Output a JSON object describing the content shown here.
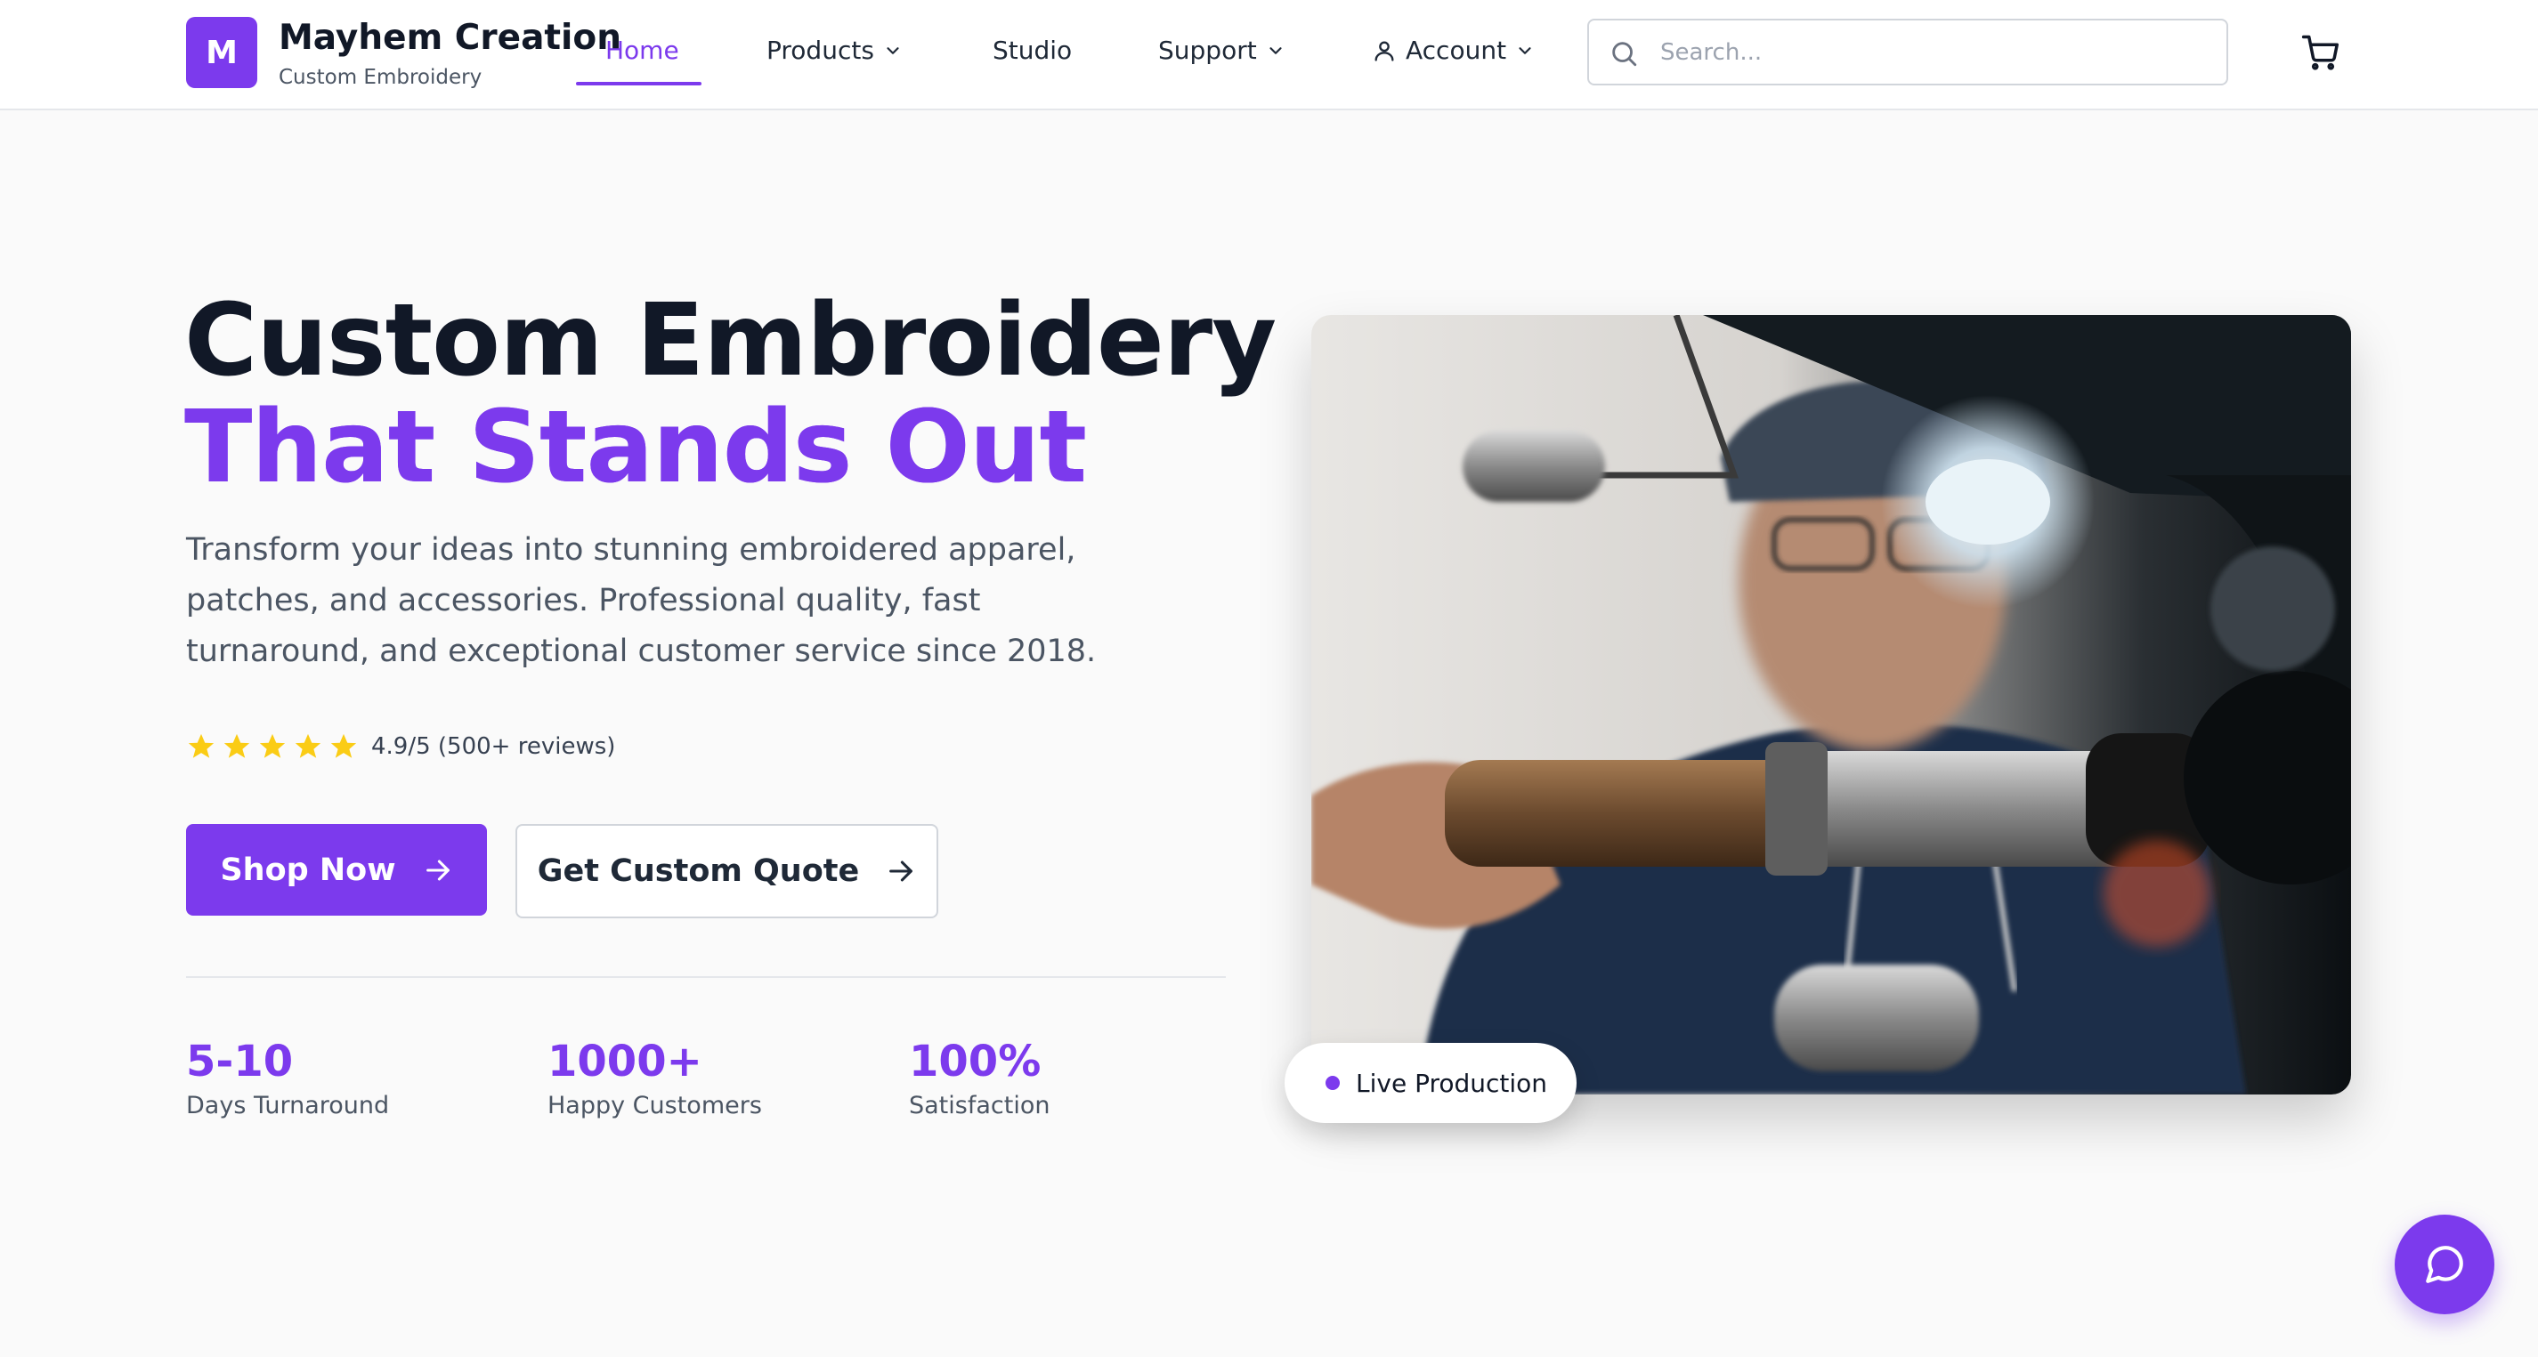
{
  "brand": {
    "logo_letter": "M",
    "name": "Mayhem Creation",
    "tagline": "Custom Embroidery"
  },
  "nav": {
    "items": [
      {
        "label": "Home",
        "active": true,
        "has_dropdown": false
      },
      {
        "label": "Products",
        "active": false,
        "has_dropdown": true
      },
      {
        "label": "Studio",
        "active": false,
        "has_dropdown": false
      },
      {
        "label": "Support",
        "active": false,
        "has_dropdown": true
      },
      {
        "label": "Account",
        "active": false,
        "has_dropdown": true,
        "icon": "user-icon"
      }
    ]
  },
  "search": {
    "placeholder": "Search...",
    "value": "",
    "icon": "search-icon"
  },
  "cart": {
    "icon": "cart-icon"
  },
  "hero": {
    "title_line1": "Custom Embroidery",
    "title_line2": "That Stands Out",
    "description": "Transform your ideas into stunning embroidered apparel, patches, and accessories. Professional quality, fast turnaround, and exceptional customer service since 2018.",
    "rating": {
      "stars": 5,
      "text": "4.9/5 (500+ reviews)"
    },
    "primary_button": "Shop Now",
    "secondary_button": "Get Custom Quote"
  },
  "stats": [
    {
      "value": "5-10",
      "label": "Days Turnaround"
    },
    {
      "value": "1000+",
      "label": "Happy Customers"
    },
    {
      "value": "100%",
      "label": "Satisfaction"
    }
  ],
  "photo": {
    "badge_text": "Live Production"
  },
  "chat": {
    "icon": "chat-bubble-icon"
  },
  "colors": {
    "accent": "#7c3aed",
    "text_dark": "#111827",
    "text_muted": "#4b5563",
    "star": "#facc15",
    "background": "#fafafa"
  }
}
